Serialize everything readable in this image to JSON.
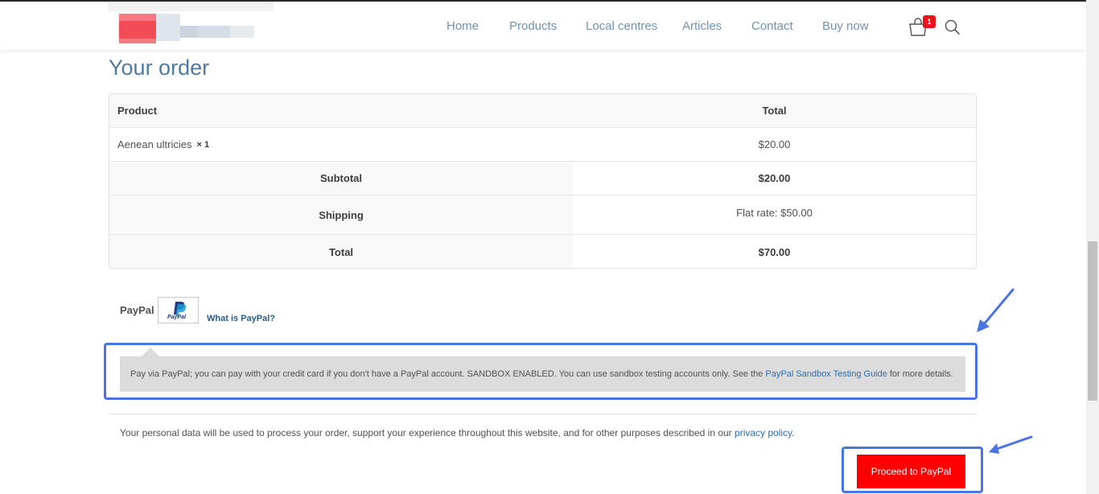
{
  "header": {
    "nav": [
      {
        "label": "Home"
      },
      {
        "label": "Products"
      },
      {
        "label": "Local centres"
      },
      {
        "label": "Articles"
      },
      {
        "label": "Contact"
      },
      {
        "label": "Buy now"
      }
    ],
    "cart_count": "1"
  },
  "page_title": "Your order",
  "order_table": {
    "headers": {
      "product": "Product",
      "total": "Total"
    },
    "item": {
      "name": "Aenean ultricies",
      "qty": "× 1",
      "total": "$20.00"
    },
    "subtotal": {
      "label": "Subtotal",
      "value": "$20.00"
    },
    "shipping": {
      "label": "Shipping",
      "value": "Flat rate: $50.00"
    },
    "total": {
      "label": "Total",
      "value": "$70.00"
    }
  },
  "payment": {
    "method_label": "PayPal",
    "logo_text": "PayPal",
    "what_is_link": "What is PayPal?",
    "description_before": "Pay via PayPal; you can pay with your credit card if you don't have a PayPal account. SANDBOX ENABLED. You can use sandbox testing accounts only. See the",
    "description_link": "PayPal Sandbox Testing Guide",
    "description_after": "for more details."
  },
  "privacy": {
    "text": "Your personal data will be used to process your order, support your experience throughout this website, and for other purposes described in our",
    "link": "privacy policy",
    "end": "."
  },
  "proceed_button": "Proceed to PayPal",
  "colors": {
    "accent_blue": "#4f7ba3",
    "annotation_blue": "#4a73e3",
    "button_red": "#ff0000",
    "badge_red": "#e8141b"
  }
}
